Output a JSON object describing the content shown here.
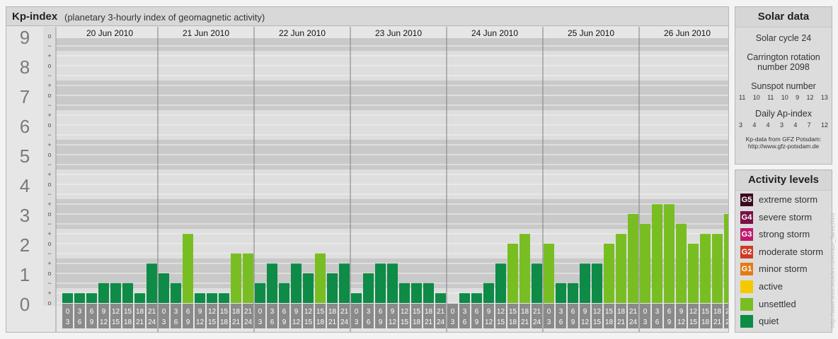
{
  "header": {
    "title": "Kp-index",
    "subtitle": "(planetary 3-hourly index of geomagnetic activity)"
  },
  "chart_data": {
    "type": "bar",
    "title": "Kp-index",
    "subtitle": "(planetary 3-hourly index of geomagnetic activity)",
    "ylim": [
      0,
      9
    ],
    "y_ticks": [
      "0",
      "1",
      "2",
      "3",
      "4",
      "5",
      "6",
      "7",
      "8",
      "9"
    ],
    "sub_ticks": [
      "o",
      "+",
      "−",
      "o",
      "+",
      "−",
      "o",
      "+",
      "−",
      "o",
      "+",
      "−",
      "o",
      "+",
      "−",
      "o",
      "+",
      "−",
      "o",
      "+",
      "−",
      "o",
      "+",
      "−",
      "o",
      "+",
      "−",
      "o"
    ],
    "days": [
      "20 Jun 2010",
      "21 Jun 2010",
      "22 Jun 2010",
      "23 Jun 2010",
      "24 Jun 2010",
      "25 Jun 2010",
      "26 Jun 2010"
    ],
    "interval_starts": [
      "0",
      "3",
      "6",
      "9",
      "12",
      "15",
      "18",
      "21"
    ],
    "interval_ends": [
      "3",
      "6",
      "9",
      "12",
      "15",
      "18",
      "21",
      "24"
    ],
    "values": [
      [
        0.33,
        0.33,
        0.33,
        0.67,
        0.67,
        0.67,
        0.33,
        1.33
      ],
      [
        1.0,
        0.67,
        2.33,
        0.33,
        0.33,
        0.33,
        1.67,
        1.67
      ],
      [
        0.67,
        1.33,
        0.67,
        1.33,
        1.0,
        1.67,
        1.0,
        1.33
      ],
      [
        0.33,
        1.0,
        1.33,
        1.33,
        0.67,
        0.67,
        0.67,
        0.33
      ],
      [
        0,
        0.33,
        0.33,
        0.67,
        1.33,
        2.0,
        2.33,
        1.33
      ],
      [
        2.0,
        0.67,
        0.67,
        1.33,
        1.33,
        2.0,
        2.33,
        3.0
      ],
      [
        2.67,
        3.33,
        3.33,
        2.67,
        2.0,
        2.33,
        2.33,
        3.0
      ]
    ],
    "levels": [
      [
        1,
        1,
        1,
        1,
        1,
        1,
        1,
        1
      ],
      [
        1,
        1,
        2,
        1,
        1,
        1,
        2,
        2
      ],
      [
        1,
        1,
        1,
        1,
        1,
        2,
        1,
        1
      ],
      [
        1,
        1,
        1,
        1,
        1,
        1,
        1,
        1
      ],
      [
        1,
        1,
        1,
        1,
        1,
        2,
        2,
        1
      ],
      [
        2,
        1,
        1,
        1,
        1,
        2,
        2,
        2
      ],
      [
        2,
        2,
        2,
        2,
        2,
        2,
        2,
        2
      ]
    ],
    "colors": {
      "quiet": "#0d8b47",
      "unsettled": "#78be22"
    }
  },
  "solar": {
    "title": "Solar data",
    "cycle": "Solar cycle 24",
    "carrington": "Carrington rotation number 2098",
    "sunspot_label": "Sunspot number",
    "sunspot_values": [
      "11",
      "10",
      "11",
      "10",
      "9",
      "12",
      "13"
    ],
    "ap_label": "Daily Ap-index",
    "ap_values": [
      "3",
      "4",
      "4",
      "3",
      "4",
      "7",
      "12"
    ],
    "credit_line1": "Kp-data from GFZ Potsdam:",
    "credit_line2": "http://www.gfz-potsdam.de"
  },
  "activity": {
    "title": "Activity levels",
    "items": [
      {
        "badge": "G5",
        "label": "extreme storm",
        "color": "#3b0a1e"
      },
      {
        "badge": "G4",
        "label": "severe storm",
        "color": "#7a1046"
      },
      {
        "badge": "G3",
        "label": "strong storm",
        "color": "#c0186e"
      },
      {
        "badge": "G2",
        "label": "moderate storm",
        "color": "#cf3a25"
      },
      {
        "badge": "G1",
        "label": "minor storm",
        "color": "#e37b16"
      },
      {
        "badge": "",
        "label": "active",
        "color": "#f6c800"
      },
      {
        "badge": "",
        "label": "unsettled",
        "color": "#78be22"
      },
      {
        "badge": "",
        "label": "quiet",
        "color": "#0d8b47"
      }
    ]
  },
  "watermark": "http://www.tesis.lebedev.ru/en/sun_flares.html"
}
